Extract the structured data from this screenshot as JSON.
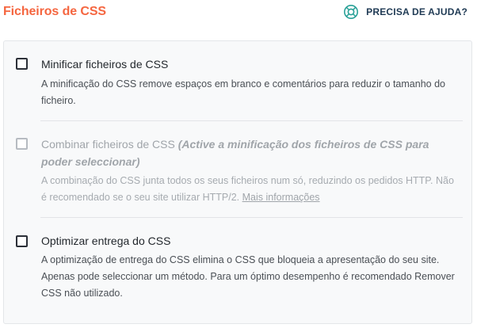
{
  "header": {
    "title": "Ficheiros de CSS",
    "help_label": "PRECISA DE AJUDA?",
    "help_icon": "lifebuoy-icon"
  },
  "options": [
    {
      "title": "Minificar ficheiros de CSS",
      "checked": false,
      "enabled": true,
      "description": "A minificação do CSS remove espaços em branco e comentários para reduzir o tamanho do ficheiro."
    },
    {
      "title": "Combinar ficheiros de CSS",
      "note": "(Active a minificação dos ficheiros de CSS para poder seleccionar)",
      "checked": false,
      "enabled": false,
      "description": "A combinação do CSS junta todos os seus ficheiros num só, reduzindo os pedidos HTTP. Não é recomendado se o seu site utilizar HTTP/2.",
      "link_text": "Mais informações"
    },
    {
      "title": "Optimizar entrega do CSS",
      "checked": false,
      "enabled": true,
      "description": "A optimização de entrega do CSS elimina o CSS que bloqueia a apresentação do seu site. Apenas pode seleccionar um método. Para um óptimo desempenho é recomendado Remover CSS não utilizado."
    }
  ],
  "colors": {
    "accent": "#f56640",
    "help_text": "#1f3a54",
    "panel_bg": "#f8f9fa"
  }
}
